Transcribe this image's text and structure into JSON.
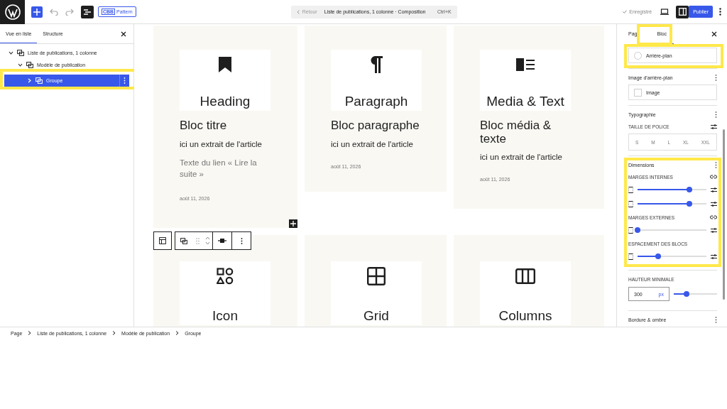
{
  "topbar": {
    "badge": "CBB",
    "pattern": "Pattern",
    "back": "Retour",
    "title": "Liste de publications, 1 colonne · Composition",
    "shortcut": "Ctrl+K",
    "saved": "Enregistré",
    "publish": "Publier"
  },
  "list_view": {
    "tabs": [
      {
        "label": "Vue en liste",
        "selected": true
      },
      {
        "label": "Structure",
        "selected": false
      }
    ],
    "tree": [
      {
        "label": "Liste de publications, 1 colonne",
        "expanded": true,
        "selected": false,
        "children": [
          {
            "label": "Modèle de publication",
            "expanded": true,
            "selected": false,
            "children": [
              {
                "label": "Groupe",
                "expanded": false,
                "selected": true
              }
            ]
          }
        ]
      }
    ]
  },
  "cards": [
    {
      "kind": "heading",
      "image_title": "Heading",
      "title": "Bloc titre",
      "excerpt": "ici un extrait de l'article",
      "link": "Texte du lien « Lire la suite »",
      "date": "août 11, 2026"
    },
    {
      "kind": "paragraph",
      "image_title": "Paragraph",
      "title": "Bloc paragraphe",
      "excerpt": "ici un extrait de l'article",
      "date": "août 11, 2026"
    },
    {
      "kind": "media",
      "image_title": "Media & Text",
      "title": "Bloc média & texte",
      "excerpt": "ici un extrait de l'article",
      "date": "août 11, 2026"
    },
    {
      "kind": "icon",
      "image_title": "Icon"
    },
    {
      "kind": "grid",
      "image_title": "Grid"
    },
    {
      "kind": "columns",
      "image_title": "Columns"
    }
  ],
  "settings": {
    "tabs": [
      {
        "label": "Pag",
        "selected": false
      },
      {
        "label": "Bloc",
        "selected": true
      }
    ],
    "background": "Arrière-plan",
    "background_image": {
      "title": "Image d'arrière-plan",
      "button": "Image"
    },
    "typography": {
      "title": "Typographie",
      "label": "TAILLE DE POLICE",
      "sizes": [
        "S",
        "M",
        "L",
        "XL",
        "XXL"
      ]
    },
    "dimensions": {
      "title": "Dimensions",
      "groups": [
        {
          "label": "MARGES INTERNES",
          "linked": true,
          "sliders": [
            {
              "level": 0.75
            },
            {
              "level": 0.75
            }
          ]
        },
        {
          "label": "MARGES EXTERNES",
          "linked": true,
          "sliders": [
            {
              "level": 0
            }
          ]
        },
        {
          "label": "ESPACEMENT DES BLOCS",
          "linked": false,
          "sliders": [
            {
              "level": 0.3
            }
          ]
        }
      ]
    },
    "min_height": {
      "label": "HAUTEUR MINIMALE",
      "value": "300",
      "unit": "px",
      "level": 0.3
    },
    "border": "Bordure & ombre"
  },
  "breadcrumb": [
    "Page",
    "Liste de publications, 1 colonne",
    "Modèle de publication",
    "Groupe"
  ]
}
